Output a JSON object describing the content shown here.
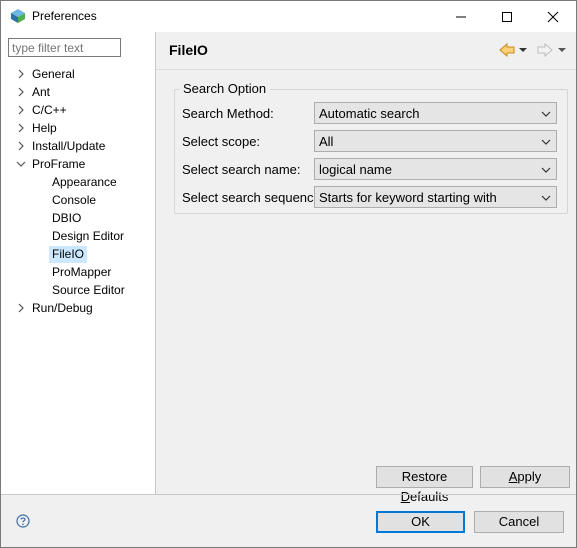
{
  "window": {
    "title": "Preferences"
  },
  "filter": {
    "placeholder": "type filter text"
  },
  "tree": {
    "roots": [
      {
        "label": "General",
        "expanded": false
      },
      {
        "label": "Ant",
        "expanded": false
      },
      {
        "label": "C/C++",
        "expanded": false
      },
      {
        "label": "Help",
        "expanded": false
      },
      {
        "label": "Install/Update",
        "expanded": false
      },
      {
        "label": "ProFrame",
        "expanded": true
      },
      {
        "label": "Run/Debug",
        "expanded": false
      }
    ],
    "proframe_children": [
      {
        "label": "Appearance"
      },
      {
        "label": "Console"
      },
      {
        "label": "DBIO"
      },
      {
        "label": "Design Editor"
      },
      {
        "label": "FileIO",
        "selected": true
      },
      {
        "label": "ProMapper"
      },
      {
        "label": "Source Editor"
      }
    ]
  },
  "page": {
    "title": "FileIO"
  },
  "search_option": {
    "group_title": "Search Option",
    "rows": [
      {
        "label": "Search Method:",
        "value": "Automatic search"
      },
      {
        "label": "Select scope:",
        "value": "All"
      },
      {
        "label": "Select search name:",
        "value": "logical name"
      },
      {
        "label": "Select search sequence:",
        "value": "Starts for keyword starting with"
      }
    ]
  },
  "buttons": {
    "restore_defaults_pre": "Restore ",
    "restore_defaults_mn": "D",
    "restore_defaults_post": "efaults",
    "apply_mn": "A",
    "apply_post": "pply",
    "ok": "OK",
    "cancel": "Cancel"
  },
  "colors": {
    "selection": "#cce8ff",
    "default_button_border": "#0078d7",
    "nav_back_arrow": "#e8a83a"
  },
  "icons": {
    "app": "preferences-app-icon",
    "back": "back-arrow-icon",
    "forward": "forward-arrow-icon",
    "help": "help-icon"
  }
}
